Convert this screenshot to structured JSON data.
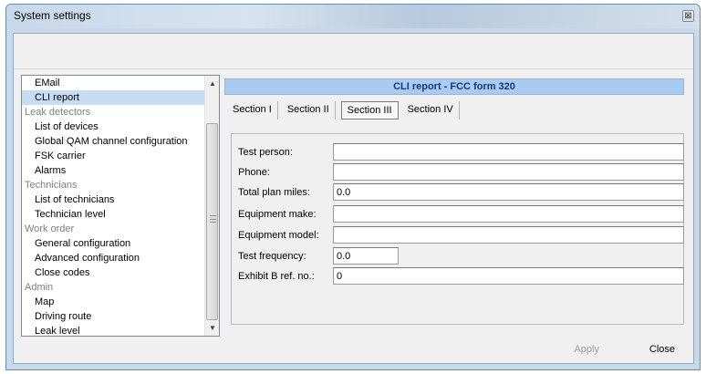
{
  "window": {
    "title": "System settings",
    "close_glyph": "⊠"
  },
  "tree": {
    "items": [
      {
        "label": "EMail",
        "type": "item",
        "selected": false
      },
      {
        "label": "CLI report",
        "type": "item",
        "selected": true
      },
      {
        "label": "Leak detectors",
        "type": "group",
        "selected": false
      },
      {
        "label": "List of devices",
        "type": "item",
        "selected": false
      },
      {
        "label": "Global QAM channel configuration",
        "type": "item",
        "selected": false
      },
      {
        "label": "FSK carrier",
        "type": "item",
        "selected": false
      },
      {
        "label": "Alarms",
        "type": "item",
        "selected": false
      },
      {
        "label": "Technicians",
        "type": "group",
        "selected": false
      },
      {
        "label": "List of technicians",
        "type": "item",
        "selected": false
      },
      {
        "label": "Technician level",
        "type": "item",
        "selected": false
      },
      {
        "label": "Work order",
        "type": "group",
        "selected": false
      },
      {
        "label": "General configuration",
        "type": "item",
        "selected": false
      },
      {
        "label": "Advanced configuration",
        "type": "item",
        "selected": false
      },
      {
        "label": "Close codes",
        "type": "item",
        "selected": false
      },
      {
        "label": "Admin",
        "type": "group",
        "selected": false
      },
      {
        "label": "Map",
        "type": "item",
        "selected": false
      },
      {
        "label": "Driving route",
        "type": "item",
        "selected": false
      },
      {
        "label": "Leak level",
        "type": "item",
        "selected": false
      }
    ]
  },
  "panel": {
    "header": "CLI report - FCC form 320",
    "tabs": [
      {
        "label": "Section I",
        "active": false
      },
      {
        "label": "Section II",
        "active": false
      },
      {
        "label": "Section III",
        "active": true
      },
      {
        "label": "Section IV",
        "active": false
      }
    ],
    "fields": [
      {
        "label": "Test person:",
        "value": "",
        "name": "test-person-input"
      },
      {
        "label": "Phone:",
        "value": "",
        "name": "phone-input"
      },
      {
        "label": "Total plan miles:",
        "value": "0.0",
        "name": "total-plan-miles-input"
      },
      {
        "label": "Equipment make:",
        "value": "",
        "name": "equipment-make-input"
      },
      {
        "label": "Equipment model:",
        "value": "",
        "name": "equipment-model-input"
      },
      {
        "label": "Test frequency:",
        "value": "0.0",
        "name": "test-frequency-input"
      },
      {
        "label": "Exhibit B ref. no.:",
        "value": "0",
        "name": "exhibit-b-ref-input"
      }
    ]
  },
  "buttons": {
    "apply": "Apply",
    "close": "Close"
  },
  "colors": {
    "selection": "#c7dcf3",
    "header_bg": "#a9cbf0",
    "header_text": "#123a78",
    "disabled_text": "#9b9b9b"
  }
}
